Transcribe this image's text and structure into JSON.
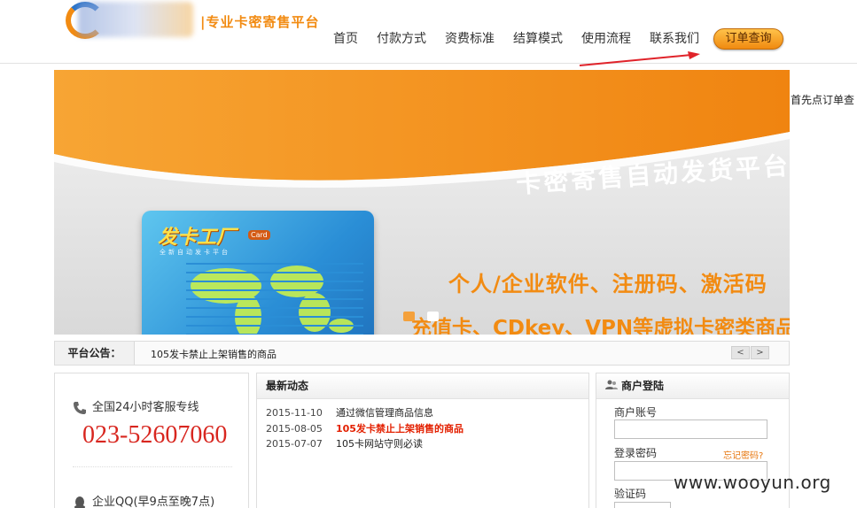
{
  "header": {
    "slogan": "|专业卡密寄售平台",
    "nav": [
      "首页",
      "付款方式",
      "资费标准",
      "结算模式",
      "使用流程",
      "联系我们"
    ],
    "order_button": "订单查询"
  },
  "annotation": {
    "side_note": "首先点订单查"
  },
  "banner": {
    "title": "卡密寄售自动发货平台",
    "line1": "个人/企业软件、注册码、激活码",
    "line2": "充值卡、CDkey、VPN等虚拟卡密类商品",
    "card_brand": "发卡工厂",
    "card_tag": "Card",
    "card_sub": "全新自动发卡平台",
    "slides_total": 2,
    "slide_active": 1
  },
  "notice": {
    "label": "平台公告：",
    "text": "105发卡禁止上架销售的商品",
    "prev": "<",
    "next": ">"
  },
  "service": {
    "hotline_label": "全国24小时客服专线",
    "phone": "023-52607060",
    "qq_label": "企业QQ(早9点至晚7点)"
  },
  "news": {
    "title": "最新动态",
    "items": [
      {
        "date": "2015-11-10",
        "title": "通过微信管理商品信息",
        "hot": false
      },
      {
        "date": "2015-08-05",
        "title": "105发卡禁止上架销售的商品",
        "hot": true
      },
      {
        "date": "2015-07-07",
        "title": "105卡网站守则必读",
        "hot": false
      }
    ]
  },
  "login": {
    "title": "商户登陆",
    "account_label": "商户账号",
    "password_label": "登录密码",
    "forgot": "忘记密码?",
    "captcha_label": "验证码"
  },
  "watermark": "www.wooyun.org",
  "colors": {
    "accent": "#f28b12",
    "hot": "#e32000",
    "phone": "#d8261f"
  }
}
